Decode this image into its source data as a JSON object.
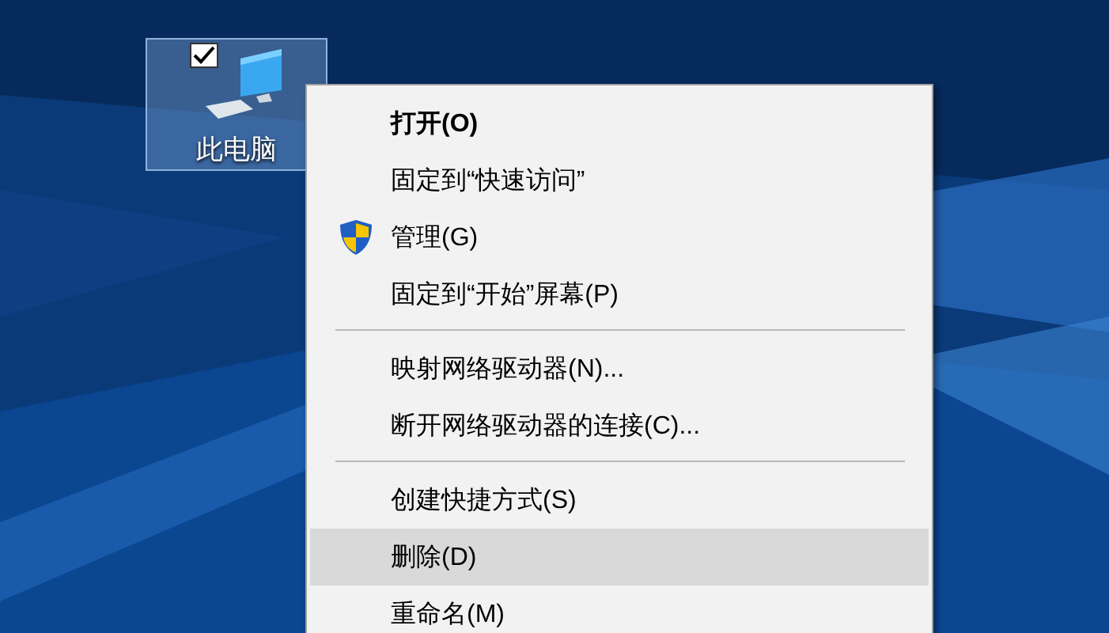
{
  "desktop_icons": [
    {
      "label": "此电脑",
      "selected": true,
      "checked": true
    }
  ],
  "context_menu": {
    "items": [
      {
        "kind": "item",
        "label": "打开(O)",
        "default": true,
        "selected": false
      },
      {
        "kind": "item",
        "label": "固定到“快速访问”",
        "default": false,
        "selected": false
      },
      {
        "kind": "shield_item",
        "label": "管理(G)",
        "default": false,
        "selected": false
      },
      {
        "kind": "item",
        "label": "固定到“开始”屏幕(P)",
        "default": false,
        "selected": false
      },
      {
        "kind": "separator"
      },
      {
        "kind": "item",
        "label": "映射网络驱动器(N)...",
        "default": false,
        "selected": false
      },
      {
        "kind": "item",
        "label": "断开网络驱动器的连接(C)...",
        "default": false,
        "selected": false
      },
      {
        "kind": "separator"
      },
      {
        "kind": "item",
        "label": "创建快捷方式(S)",
        "default": false,
        "selected": false
      },
      {
        "kind": "item",
        "label": "删除(D)",
        "default": false,
        "selected": true
      },
      {
        "kind": "item",
        "label": "重命名(M)",
        "default": false,
        "selected": false
      }
    ]
  }
}
